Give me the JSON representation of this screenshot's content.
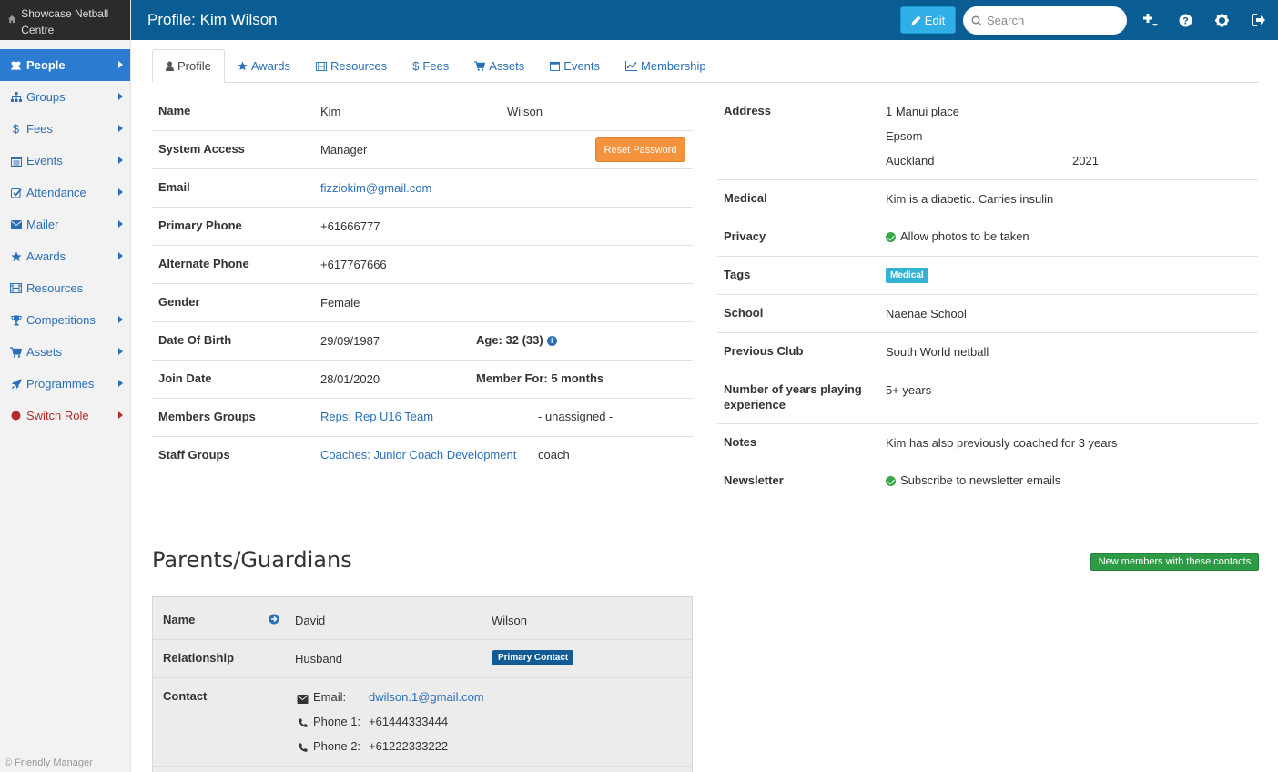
{
  "app": {
    "brand": "Showcase Netball Centre",
    "footer": "© Friendly Manager"
  },
  "header": {
    "title": "Profile: Kim Wilson",
    "edit_label": "Edit",
    "search_placeholder": "Search"
  },
  "sidebar": {
    "items": [
      {
        "label": "People",
        "icon": "users-icon"
      },
      {
        "label": "Groups",
        "icon": "sitemap-icon"
      },
      {
        "label": "Fees",
        "icon": "dollar-icon"
      },
      {
        "label": "Events",
        "icon": "calendar-icon"
      },
      {
        "label": "Attendance",
        "icon": "check-square-icon"
      },
      {
        "label": "Mailer",
        "icon": "envelope-icon"
      },
      {
        "label": "Awards",
        "icon": "star-icon"
      },
      {
        "label": "Resources",
        "icon": "film-icon"
      },
      {
        "label": "Competitions",
        "icon": "trophy-icon"
      },
      {
        "label": "Assets",
        "icon": "cart-icon"
      },
      {
        "label": "Programmes",
        "icon": "rocket-icon"
      },
      {
        "label": "Switch Role",
        "icon": "circle-icon"
      }
    ]
  },
  "tabs": [
    "Profile",
    "Awards",
    "Resources",
    "Fees",
    "Assets",
    "Events",
    "Membership"
  ],
  "profile": {
    "name_label": "Name",
    "first_name": "Kim",
    "last_name": "Wilson",
    "access_label": "System Access",
    "access": "Manager",
    "reset_label": "Reset Password",
    "email_label": "Email",
    "email": "fizziokim@gmail.com",
    "phone_label": "Primary Phone",
    "phone": "+61666777",
    "alt_phone_label": "Alternate Phone",
    "alt_phone": "+617767666",
    "gender_label": "Gender",
    "gender": "Female",
    "dob_label": "Date Of Birth",
    "dob": "29/09/1987",
    "age": "Age: 32 (33)",
    "join_label": "Join Date",
    "join": "28/01/2020",
    "member_for": "Member For: 5 months",
    "members_groups_label": "Members Groups",
    "members_group": "Reps: Rep U16 Team",
    "members_group_role": "- unassigned -",
    "staff_groups_label": "Staff Groups",
    "staff_group": "Coaches: Junior Coach Development",
    "staff_group_role": "coach"
  },
  "details": {
    "address_label": "Address",
    "address_line1": "1 Manui place",
    "address_line2": "Epsom",
    "address_city": "Auckland",
    "address_postcode": "2021",
    "medical_label": "Medical",
    "medical": "Kim is a diabetic. Carries insulin",
    "privacy_label": "Privacy",
    "privacy": "Allow photos to be taken",
    "tags_label": "Tags",
    "tag": "Medical",
    "school_label": "School",
    "school": "Naenae School",
    "prev_club_label": "Previous Club",
    "prev_club": "South World netball",
    "years_label_1": "Number of years playing",
    "years_label_2": "experience",
    "years": "5+ years",
    "notes_label": "Notes",
    "notes": "Kim has also previously coached for 3 years",
    "newsletter_label": "Newsletter",
    "newsletter": "Subscribe to newsletter emails"
  },
  "guardians": {
    "title": "Parents/Guardians",
    "new_button": "New members with these contacts",
    "name_label": "Name",
    "first_name": "David",
    "last_name": "Wilson",
    "relationship_label": "Relationship",
    "relationship": "Husband",
    "primary_badge": "Primary Contact",
    "contact_label": "Contact",
    "email_label": "Email:",
    "email": "dwilson.1@gmail.com",
    "phone1_label": "Phone 1:",
    "phone1": "+61444333444",
    "phone2_label": "Phone 2:",
    "phone2": "+61222333222"
  },
  "colors": {
    "header": "#0a5d93",
    "nav_active": "#2a7bd1",
    "link": "#2a6fb7",
    "reset": "#f5923e",
    "new_button": "#2e9a46"
  }
}
